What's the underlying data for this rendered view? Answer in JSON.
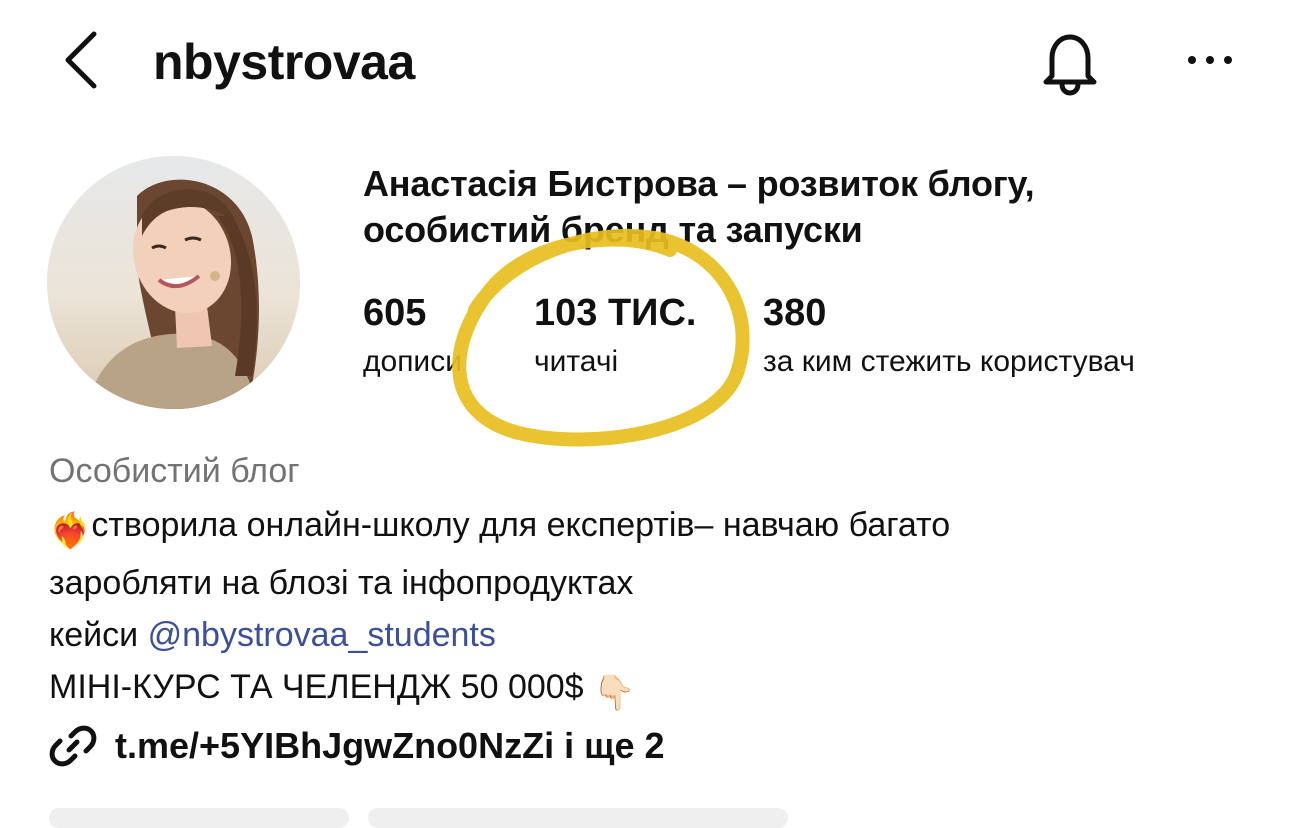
{
  "header": {
    "username": "nbystrovaa",
    "back_icon": "chevron-left-icon",
    "bell_icon": "bell-icon",
    "more_icon": "more-horizontal-icon"
  },
  "profile": {
    "name_line1": "Анастасія Бистрова – розвиток блогу,",
    "name_line2": "особистий бренд та запуски",
    "stats": {
      "posts": {
        "value": "605",
        "label": "дописи"
      },
      "followers": {
        "value": "103 ТИС.",
        "label": "читачі"
      },
      "following": {
        "value": "380",
        "label": "за ким стежить користувач"
      }
    },
    "highlight_color": "#E8BE1E"
  },
  "bio": {
    "category": "Особистий блог",
    "line1_emoji": "❤️‍🔥",
    "line1_text": "створила онлайн-школу для експертів– навчаю багато",
    "line2_text": "заробляти на блозі та інфопродуктах",
    "line3_prefix": "кейси ",
    "line3_mention": "@nbystrovaa_students",
    "line4_text": "МІНІ-КУРС ТА ЧЕЛЕНДЖ 50 000$",
    "line4_emoji": "👇🏻"
  },
  "link": {
    "icon": "link-icon",
    "text": "t.me/+5YIBhJgwZno0NzZi і ще 2"
  }
}
